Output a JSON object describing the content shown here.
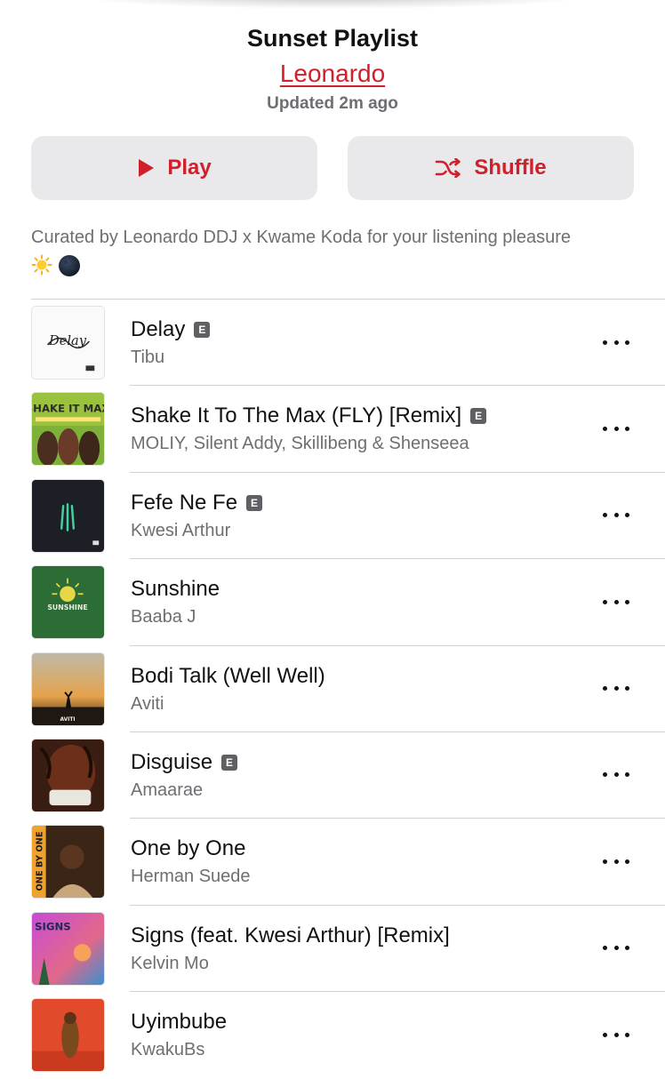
{
  "playlist": {
    "title": "Sunset Playlist",
    "curator": "Leonardo",
    "updated": "Updated 2m ago"
  },
  "actions": {
    "play_label": "Play",
    "shuffle_label": "Shuffle",
    "accent": "#d0202b"
  },
  "description": {
    "text": "Curated by Leonardo DDJ x Kwame Koda for your listening pleasure",
    "emojis": [
      "sun-emoji",
      "moon-emoji"
    ]
  },
  "tracks": [
    {
      "title": "Delay",
      "artist": "Tibu",
      "explicit": true,
      "artwork_text": "Delay"
    },
    {
      "title": "Shake It To The Max (FLY) [Remix]",
      "artist": "MOLIY, Silent Addy, Skillibeng & Shenseea",
      "explicit": true,
      "artwork_text": "SHAKE IT MAX"
    },
    {
      "title": "Fefe Ne Fe",
      "artist": "Kwesi Arthur",
      "explicit": true,
      "artwork_text": ""
    },
    {
      "title": "Sunshine",
      "artist": "Baaba J",
      "explicit": false,
      "artwork_text": "SUNSHINE"
    },
    {
      "title": "Bodi Talk (Well Well)",
      "artist": "Aviti",
      "explicit": false,
      "artwork_text": "AVITI"
    },
    {
      "title": "Disguise",
      "artist": "Amaarae",
      "explicit": true,
      "artwork_text": ""
    },
    {
      "title": "One by One",
      "artist": "Herman Suede",
      "explicit": false,
      "artwork_text": "ONE BY ONE"
    },
    {
      "title": "Signs (feat. Kwesi Arthur) [Remix]",
      "artist": "Kelvin Mo",
      "explicit": false,
      "artwork_text": "SIGNS"
    },
    {
      "title": "Uyimbube",
      "artist": "KwakuBs",
      "explicit": false,
      "artwork_text": ""
    }
  ],
  "explicit_badge": "E"
}
